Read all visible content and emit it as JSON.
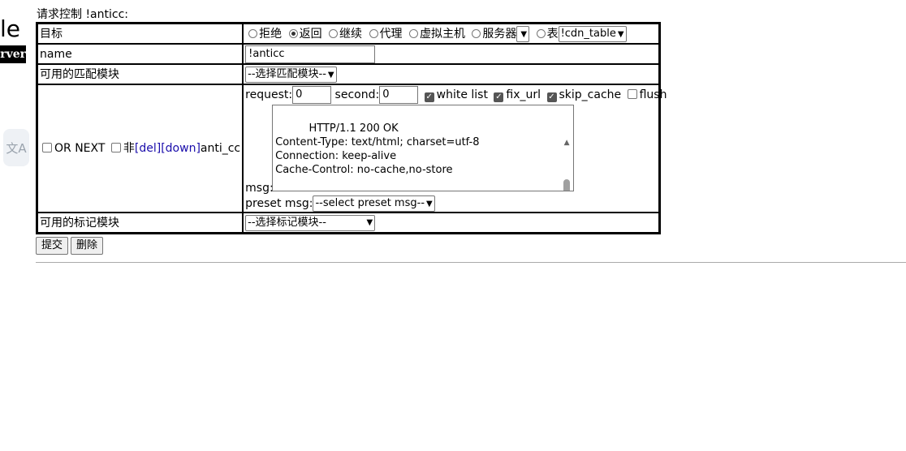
{
  "side": {
    "fragment": "le",
    "badge": "rver",
    "translate_icon": "文A"
  },
  "page_title": "请求控制 !anticc:",
  "rows": {
    "target": {
      "label": "目标",
      "options": [
        {
          "label": "拒绝",
          "checked": false
        },
        {
          "label": "返回",
          "checked": true
        },
        {
          "label": "继续",
          "checked": false
        },
        {
          "label": "代理",
          "checked": false
        },
        {
          "label": "虚拟主机",
          "checked": false
        },
        {
          "label": "服务器",
          "checked": false
        }
      ],
      "server_select": "",
      "table_label": "表",
      "table_select": "!cdn_table"
    },
    "name": {
      "label": "name",
      "value": "!anticc"
    },
    "match": {
      "label": "可用的匹配模块",
      "select": "--选择匹配模块--"
    },
    "anticc": {
      "or_next": "OR NEXT",
      "not": "非",
      "del": "[del]",
      "down": "[down]",
      "module": "anti_cc",
      "request_label": "request:",
      "request_value": "0",
      "second_label": "second:",
      "second_value": "0",
      "white_list": "white list",
      "fix_url": "fix_url",
      "skip_cache": "skip_cache",
      "flush": "flush",
      "msg_label": "msg:",
      "msg_text": "HTTP/1.1 200 OK\nContent-Type: text/html; charset=utf-8\nConnection: keep-alive\nCache-Control: no-cache,no-store\n\n<!DOCTYPE html><html id='anticc_click'><head>",
      "preset_label": "preset msg:",
      "preset_select": "--select preset msg--"
    },
    "mark": {
      "label": "可用的标记模块",
      "select": "--选择标记模块--"
    }
  },
  "buttons": {
    "submit": "提交",
    "delete": "删除"
  }
}
